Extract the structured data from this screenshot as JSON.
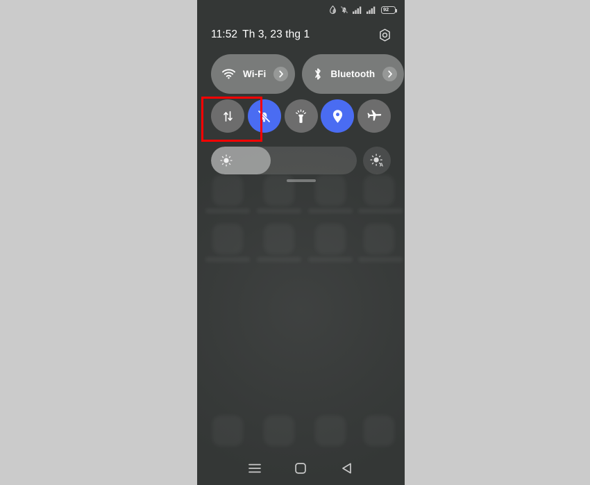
{
  "screen": {
    "device_frame_color": "#343736",
    "page_background": "#cbcbcb",
    "accent_color": "#4a6cf2"
  },
  "status_bar": {
    "icons": [
      {
        "name": "water-drop-icon",
        "glyph": "droplet"
      },
      {
        "name": "notifications-muted-icon",
        "glyph": "bell-slash"
      },
      {
        "name": "signal-sim1-icon",
        "glyph": "signal-bars"
      },
      {
        "name": "signal-sim2-icon",
        "glyph": "signal-bars"
      }
    ],
    "battery_level": "92"
  },
  "header": {
    "time": "11:52",
    "date": "Th 3, 23 thg 1",
    "settings_button": {
      "name": "gear-icon",
      "label": "Settings"
    }
  },
  "quick_pills": [
    {
      "id": "wifi",
      "label": "Wi-Fi",
      "icon": "wifi-icon",
      "chevron": "chevron-right-icon"
    },
    {
      "id": "bluetooth",
      "label": "Bluetooth",
      "icon": "bluetooth-icon",
      "chevron": "chevron-right-icon"
    }
  ],
  "toggles": [
    {
      "id": "mobile-data",
      "icon": "mobile-data-icon",
      "active": false,
      "highlighted": true
    },
    {
      "id": "silent-mode",
      "icon": "bell-slash-icon",
      "active": true,
      "highlighted": false
    },
    {
      "id": "flashlight",
      "icon": "flashlight-icon",
      "active": false,
      "highlighted": false
    },
    {
      "id": "location",
      "icon": "location-pin-icon",
      "active": true,
      "highlighted": false
    },
    {
      "id": "airplane-mode",
      "icon": "airplane-icon",
      "active": false,
      "highlighted": false
    }
  ],
  "brightness": {
    "slider_icon": "brightness-sun-icon",
    "value_percent": 41,
    "auto_button": {
      "name": "auto-brightness-icon",
      "label": "A"
    }
  },
  "nav_bar": [
    {
      "id": "recents",
      "icon": "menu-icon"
    },
    {
      "id": "home",
      "icon": "home-square-icon"
    },
    {
      "id": "back",
      "icon": "back-triangle-icon"
    }
  ],
  "annotation": {
    "highlight_color": "#ff0000",
    "target": "mobile-data"
  }
}
